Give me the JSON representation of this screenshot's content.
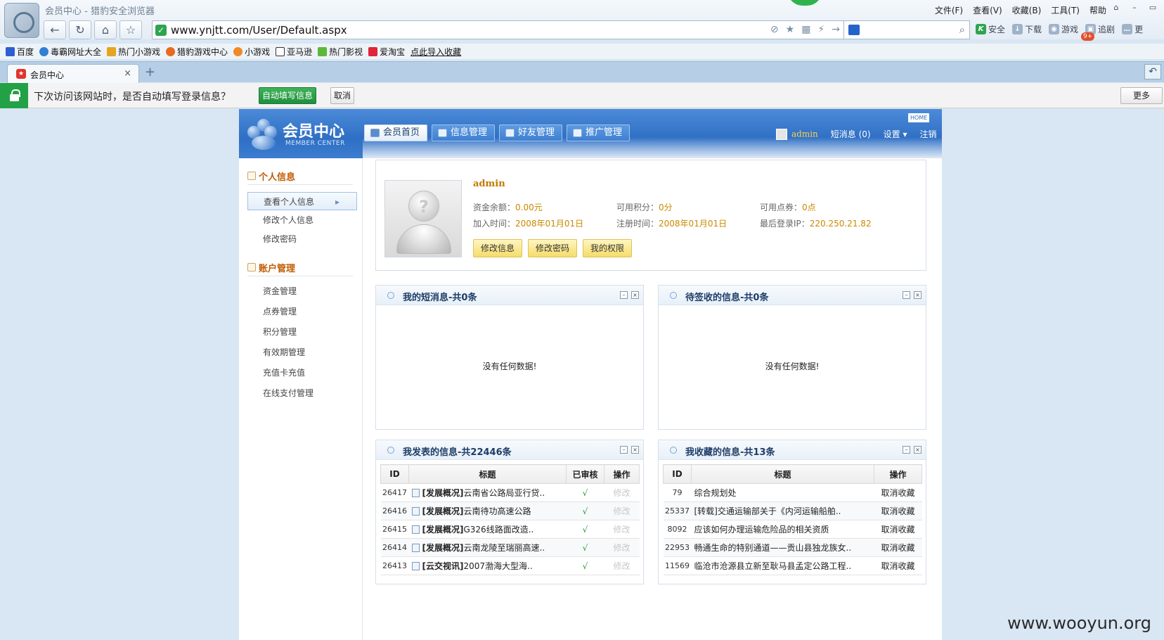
{
  "browser": {
    "window_title": "会员中心 - 猎豹安全浏览器",
    "menu": [
      "文件(F)",
      "查看(V)",
      "收藏(B)",
      "工具(T)",
      "帮助"
    ],
    "url": "www.ynjtt.com/User/Default.aspx",
    "tools": [
      "安全",
      "下载",
      "游戏",
      "追剧"
    ],
    "tools_more": "更",
    "games_badge": "9+",
    "favorites": [
      "百度",
      "毒霸网址大全",
      "热门小游戏",
      "猎豹游戏中心",
      "小游戏",
      "亚马逊",
      "热门影视",
      "爱淘宝",
      "点此导入收藏"
    ],
    "tab_label": "会员中心",
    "infobar": {
      "text": "下次访问该网站时，是否自动填写登录信息？",
      "autofill_button": "自动填写信息",
      "cancel_button": "取消",
      "more_button": "更多"
    }
  },
  "site": {
    "logo_title": "会员中心",
    "logo_sub": "MEMBER CENTER",
    "home_chip": "HOME",
    "nav_tabs": [
      "会员首页",
      "信息管理",
      "好友管理",
      "推广管理"
    ],
    "user": {
      "name": "admin",
      "messages": "短消息 (0)",
      "settings": "设置",
      "logout": "注销"
    }
  },
  "sidebar": {
    "section1": "个人信息",
    "section1_items": [
      "查看个人信息",
      "修改个人信息",
      "修改密码"
    ],
    "section2": "账户管理",
    "section2_items": [
      "资金管理",
      "点券管理",
      "积分管理",
      "有效期管理",
      "充值卡充值",
      "在线支付管理"
    ]
  },
  "profile": {
    "name": "admin",
    "balance_label": "资金余额：",
    "balance": "0.00元",
    "points_label": "可用积分：",
    "points": "0分",
    "coupons_label": "可用点券：",
    "coupons": "0点",
    "join_label": "加入时间：",
    "join": "2008年01月01日",
    "reg_label": "注册时间：",
    "reg": "2008年01月01日",
    "ip_label": "最后登录IP：",
    "ip": "220.250.21.82",
    "buttons": [
      "修改信息",
      "修改密码",
      "我的权限"
    ]
  },
  "panels": {
    "messages": {
      "title": "我的短消息-共0条",
      "empty": "没有任何数据!"
    },
    "pending": {
      "title": "待签收的信息-共0条",
      "empty": "没有任何数据!"
    },
    "published": {
      "title": "我发表的信息-共22446条",
      "headers": [
        "ID",
        "标题",
        "已审核",
        "操作"
      ],
      "rows": [
        {
          "id": "26417",
          "tag": "[发展概况]",
          "title": "云南省公路局亚行贷..",
          "check": "√",
          "op": "修改"
        },
        {
          "id": "26416",
          "tag": "[发展概况]",
          "title": "云南待功高速公路",
          "check": "√",
          "op": "修改"
        },
        {
          "id": "26415",
          "tag": "[发展概况]",
          "title": "G326线路面改造..",
          "check": "√",
          "op": "修改"
        },
        {
          "id": "26414",
          "tag": "[发展概况]",
          "title": "云南龙陵至瑞丽高速..",
          "check": "√",
          "op": "修改"
        },
        {
          "id": "26413",
          "tag": "[云交视讯]",
          "title": "2007渤海大型海..",
          "check": "√",
          "op": "修改"
        }
      ]
    },
    "favorites": {
      "title": "我收藏的信息-共13条",
      "headers": [
        "ID",
        "标题",
        "操作"
      ],
      "rows": [
        {
          "id": "79",
          "title": "综合规划处",
          "op": "取消收藏"
        },
        {
          "id": "25337",
          "title": "[转载]交通运输部关于《内河运输船舶..",
          "op": "取消收藏"
        },
        {
          "id": "8092",
          "title": "应该如何办理运输危险品的相关资质",
          "op": "取消收藏"
        },
        {
          "id": "22953",
          "title": "畅通生命的特别通道——贡山县独龙族女..",
          "op": "取消收藏"
        },
        {
          "id": "11569",
          "title": "临沧市沧源县立新至耿马县孟定公路工程..",
          "op": "取消收藏"
        }
      ]
    }
  },
  "watermark": "www.wooyun.org"
}
